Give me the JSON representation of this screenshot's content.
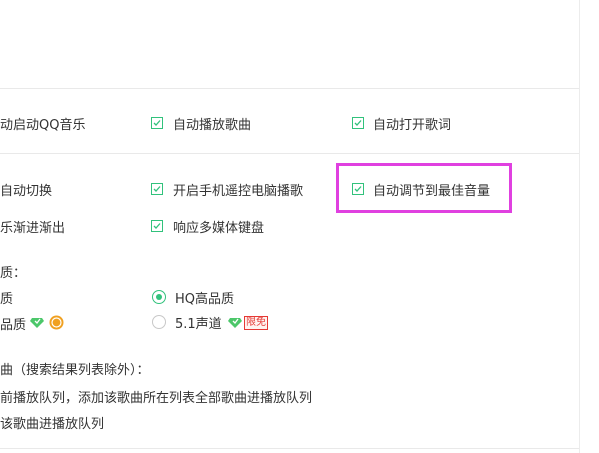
{
  "options_row1": {
    "auto_start": "动启动QQ音乐",
    "auto_play": "自动播放歌曲",
    "auto_lyrics": "自动打开歌词"
  },
  "options_row2": {
    "auto_switch": "自动切换",
    "phone_remote": "开启手机遥控电脑播歌",
    "auto_volume": "自动调节到最佳音量"
  },
  "options_row3": {
    "fade": "乐渐进渐出",
    "media_keys": "响应多媒体键盘"
  },
  "quality": {
    "heading": "质：",
    "left_option1": "质",
    "hq_option": "HQ高品质",
    "left_option2": "品质",
    "surround_option": "5.1声道",
    "free_badge": "限免"
  },
  "dblclick": {
    "heading": "曲（搜索结果列表除外）：",
    "option1": "前播放队列，添加该歌曲所在列表全部歌曲进播放队列",
    "option2": "该歌曲进播放队列"
  },
  "colors": {
    "accent": "#31c27c",
    "highlight": "#e040e0",
    "badge": "#e53935"
  }
}
